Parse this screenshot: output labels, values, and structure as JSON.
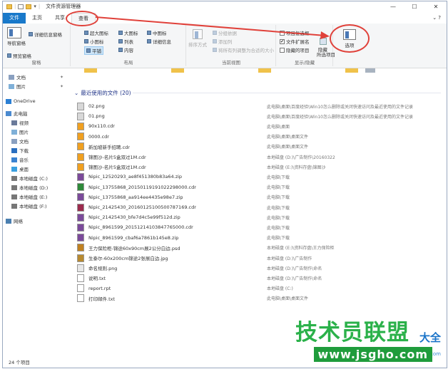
{
  "window": {
    "title": "文件资源管理器",
    "quick_access": "▾",
    "controls": [
      "—",
      "☐",
      "✕"
    ]
  },
  "tabs": [
    {
      "label": "文件"
    },
    {
      "label": "主页"
    },
    {
      "label": "共享"
    },
    {
      "label": "查看"
    }
  ],
  "ribbon": {
    "panes": {
      "nav_pane": "导航窗格",
      "preview_pane": "预览窗格",
      "details_pane": "详细信息窗格",
      "label": "窗格"
    },
    "layout": {
      "items": [
        "超大图标",
        "大图标",
        "中图标",
        "小图标",
        "列表",
        "详细信息",
        "平铺",
        "内容"
      ],
      "label": "布局"
    },
    "current_view": {
      "sort": "排序方式",
      "group": "分组依据",
      "add_column": "添加列",
      "fit_columns": "将所有列调整为合适的大小",
      "label": "当前视图"
    },
    "show_hide": {
      "item_checkboxes": "项目复选框",
      "file_extensions": "文件扩展名",
      "hidden_items": "隐藏的项目",
      "hide_selected": "隐藏",
      "hide_selected_2": "所选项目",
      "label": "显示/隐藏"
    },
    "options": {
      "label": "选项"
    }
  },
  "nav": {
    "items": [
      {
        "label": "文档",
        "icon": "documents-icon"
      },
      {
        "label": "图片",
        "icon": "pictures-icon"
      },
      {
        "label": "OneDrive",
        "icon": "onedrive-icon"
      },
      {
        "label": "此电脑",
        "icon": "computer-icon"
      },
      {
        "label": "视频",
        "icon": "videos-icon"
      },
      {
        "label": "图片",
        "icon": "pictures-icon"
      },
      {
        "label": "文档",
        "icon": "documents-icon"
      },
      {
        "label": "下载",
        "icon": "downloads-icon"
      },
      {
        "label": "音乐",
        "icon": "music-icon"
      },
      {
        "label": "桌面",
        "icon": "desktop-icon"
      },
      {
        "label": "本地磁盘 (C:)",
        "icon": "drive-icon"
      },
      {
        "label": "本地磁盘 (D:)",
        "icon": "drive-icon"
      },
      {
        "label": "本地磁盘 (E:)",
        "icon": "drive-icon"
      },
      {
        "label": "本地磁盘 (F:)",
        "icon": "drive-icon"
      },
      {
        "label": "网络",
        "icon": "network-icon"
      }
    ]
  },
  "content": {
    "group_title": "最近使用的文件 (20)",
    "files": [
      {
        "name": "02.png",
        "path": "此电脑\\桌面\\百度经验\\Win10怎么删除或关闭快速访问及最近使用的文件记录",
        "icon": "png-file-icon",
        "color": "#d8d8d8"
      },
      {
        "name": "01.png",
        "path": "此电脑\\桌面\\百度经验\\Win10怎么删除或关闭快速访问及最近使用的文件记录",
        "icon": "png-file-icon",
        "color": "#d8d8d8"
      },
      {
        "name": "90x110.cdr",
        "path": "此电脑\\桌面",
        "icon": "cdr-file-icon",
        "color": "#f0a020"
      },
      {
        "name": "0000.cdr",
        "path": "此电脑\\桌面\\桌面文件",
        "icon": "cdr-file-icon",
        "color": "#f0a020"
      },
      {
        "name": "新加坡新手招聘.cdr",
        "path": "此电脑\\桌面\\桌面文件",
        "icon": "cdr-file-icon",
        "color": "#f0a020"
      },
      {
        "name": "锦图沙-名片5盒双过1M.cdr",
        "path": "本地磁盘 (D:)\\广告制作\\20160322",
        "icon": "cdr-file-icon",
        "color": "#f0a020"
      },
      {
        "name": "锦图沙-名片5盒双过1M.cdr",
        "path": "本地磁盘 (E:)\\资料存盘\\锦图沙",
        "icon": "cdr-file-icon",
        "color": "#f0a020"
      },
      {
        "name": "Nipic_12520293_ae8f451380b83a64.zip",
        "path": "此电脑\\下载",
        "icon": "zip-file-icon",
        "color": "#7b4a9a"
      },
      {
        "name": "Nipic_13755868_20150119191022298000.cdr",
        "path": "此电脑\\下载",
        "icon": "cdr-file-icon",
        "color": "#2f8a3a"
      },
      {
        "name": "Nipic_13755868_aa914ee4435e98e7.zip",
        "path": "此电脑\\下载",
        "icon": "zip-file-icon",
        "color": "#7b4a9a"
      },
      {
        "name": "Nipic_21425430_20160125100500787169.cdr",
        "path": "此电脑\\下载",
        "icon": "cdr-file-icon",
        "color": "#9c2b4e"
      },
      {
        "name": "Nipic_21425430_bfe7d4c5e99f512d.zip",
        "path": "此电脑\\下载",
        "icon": "zip-file-icon",
        "color": "#7b4a9a"
      },
      {
        "name": "Nipic_8961599_20151214103847765000.cdr",
        "path": "此电脑\\下载",
        "icon": "cdr-file-icon",
        "color": "#7b4a9a"
      },
      {
        "name": "Nipic_8961599_cbaf6a7861b145e8.zip",
        "path": "此电脑\\下载",
        "icon": "zip-file-icon",
        "color": "#7b4a9a"
      },
      {
        "name": "王力保险柜-锦途60x90cm展2公分白边.psd",
        "path": "本地磁盘 (E:)\\资料存盘\\王力保险柜",
        "icon": "psd-file-icon",
        "color": "#c08020"
      },
      {
        "name": "生泰尔-60x200cm锦途2张展白边.jpg",
        "path": "本地磁盘 (D:)\\广告制作",
        "icon": "jpg-file-icon",
        "color": "#b88a30"
      },
      {
        "name": "命名规则.png",
        "path": "本地磁盘 (D:)\\广告制作\\命名",
        "icon": "png-file-icon",
        "color": "#e8e8e8"
      },
      {
        "name": "说明.txt",
        "path": "本地磁盘 (D:)\\广告制作\\命名",
        "icon": "txt-file-icon",
        "color": "#ffffff"
      },
      {
        "name": "report.rpt",
        "path": "本地磁盘 (C:)",
        "icon": "rpt-file-icon",
        "color": "#ffffff"
      },
      {
        "name": "打印邮件.txt",
        "path": "此电脑\\桌面\\桌面文件",
        "icon": "txt-file-icon",
        "color": "#ffffff"
      }
    ]
  },
  "status": {
    "count": "24 个项目"
  },
  "watermark": {
    "main": "技术员联盟",
    "side": "大全",
    "url": "www.jsgho.com",
    "url2": "P85.com"
  },
  "colors": {
    "accent": "#1979ca",
    "annotation": "#e0413a",
    "group_title": "#1e3287"
  }
}
